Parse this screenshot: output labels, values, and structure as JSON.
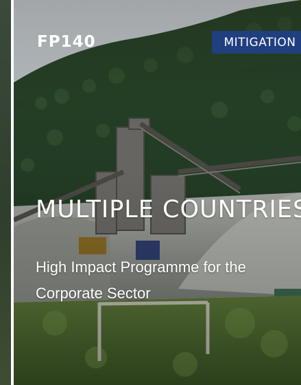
{
  "card": {
    "project_code": "FP140",
    "badge": "MITIGATION",
    "region": "MULTIPLE COUNTRIES",
    "title": "High Impact Programme for the Corporate Sector",
    "badge_color": "#1f3f7f",
    "image": "quarry-conveyor-forest-photo"
  }
}
